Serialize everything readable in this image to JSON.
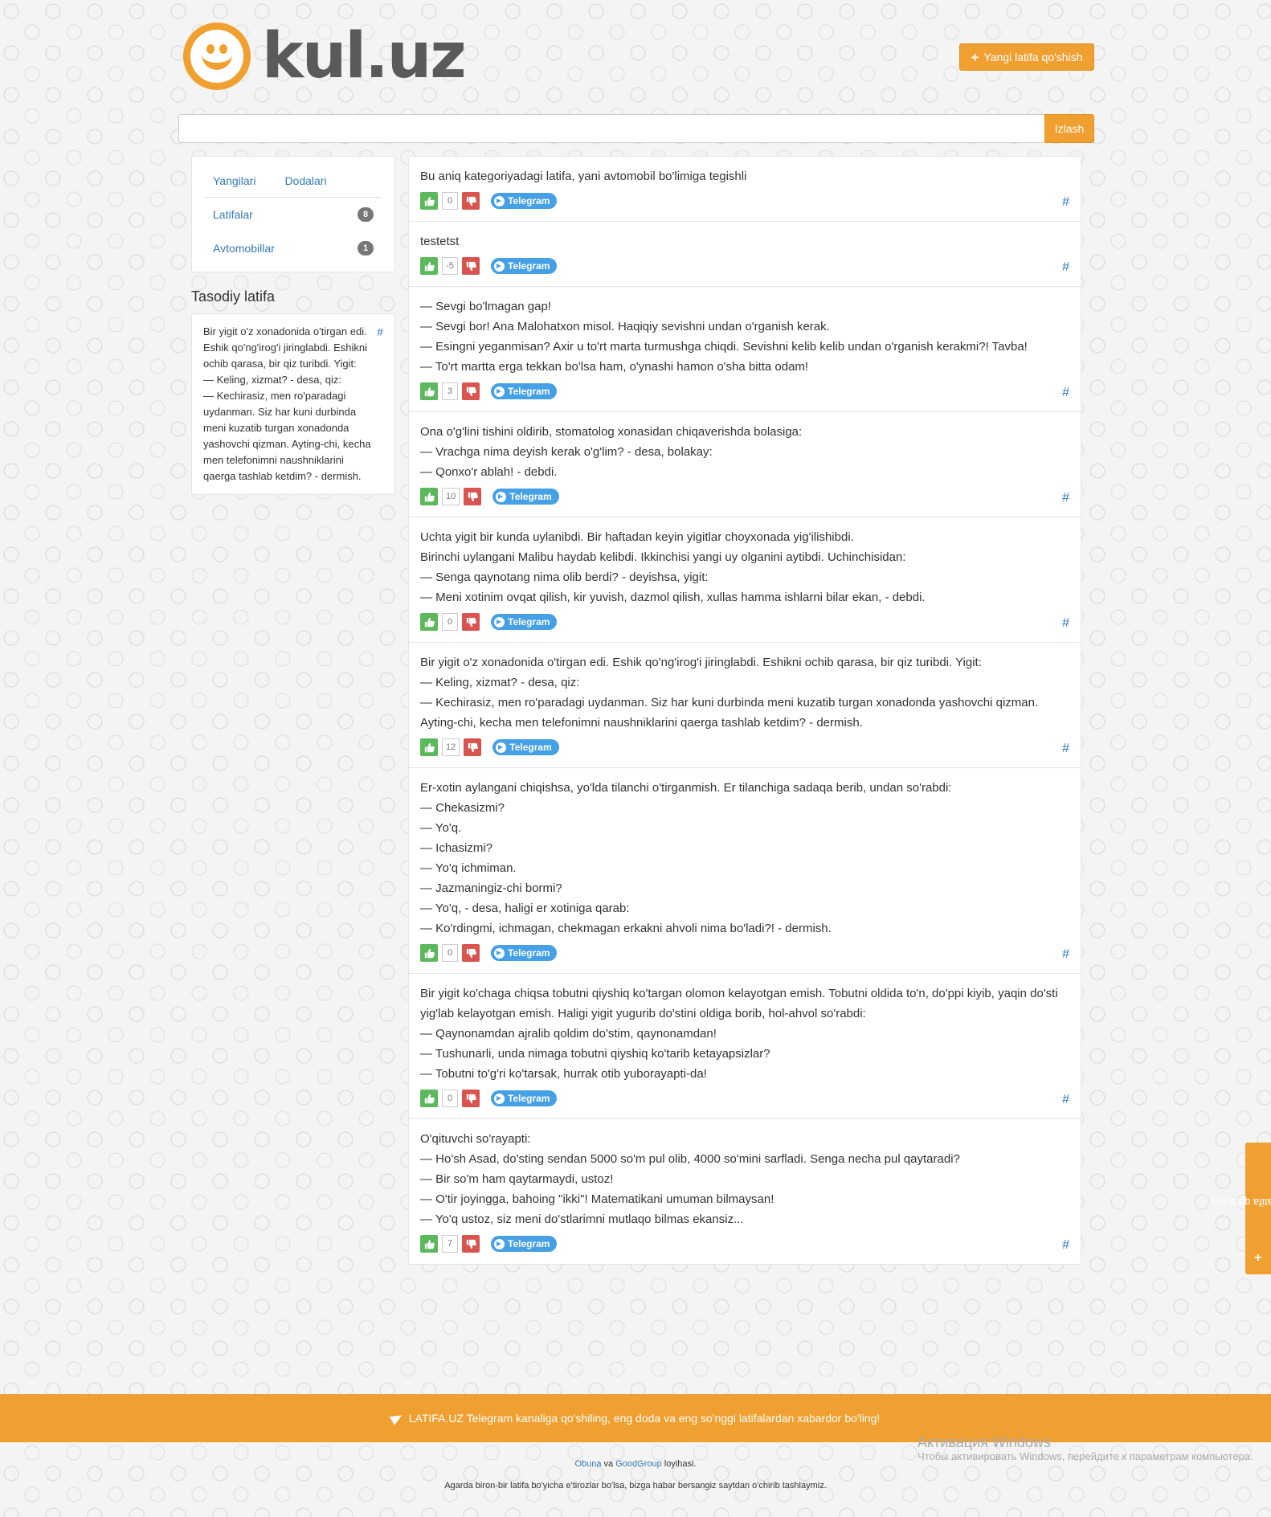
{
  "header": {
    "logo_text": "kul.uz",
    "add_button_label": "Yangi latifa qo'shish"
  },
  "search": {
    "placeholder": "",
    "button_label": "Izlash"
  },
  "sidebar": {
    "tabs": [
      "Yangilari",
      "Dodalari"
    ],
    "categories": [
      {
        "label": "Latifalar",
        "count": "8"
      },
      {
        "label": "Avtomobillar",
        "count": "1"
      }
    ],
    "random_title": "Tasodiy latifa",
    "random_hash": "#",
    "random_text": "Bir yigit o'z xonadonida o'tirgan edi. Eshik qo'ng'irog'i jiringlabdi. Eshikni ochib qarasa, bir qiz turibdi. Yigit:\n— Keling, xizmat? - desa, qiz:\n— Kechirasiz, men ro'paradagi uydanman. Siz har kuni durbinda meni kuzatib turgan xonadonda yashovchi qizman. Ayting-chi, kecha men telefonimni naushniklarini qaerga tashlab ketdim? - dermish."
  },
  "posts": [
    {
      "text": "Bu aniq kategoriyadagi latifa, yani avtomobil bo'limiga tegishli",
      "votes": "0",
      "telegram": "Telegram",
      "hash": "#"
    },
    {
      "text": "testetst",
      "votes": "-5",
      "telegram": "Telegram",
      "hash": "#"
    },
    {
      "text": "— Sevgi bo'lmagan gap!\n— Sevgi bor! Ana Malohatxon misol. Haqiqiy sevishni undan o'rganish kerak.\n— Esingni yeganmisan? Axir u to'rt marta turmushga chiqdi. Sevishni kelib kelib undan o'rganish kerakmi?! Tavba!\n— To'rt martta erga tekkan bo'lsa ham, o'ynashi hamon o'sha bitta odam!",
      "votes": "3",
      "telegram": "Telegram",
      "hash": "#"
    },
    {
      "text": "Ona o'g'lini tishini oldirib, stomatolog xonasidan chiqaverishda bolasiga:\n— Vrachga nima deyish kerak o'g'lim? - desa, bolakay:\n— Qonxo'r ablah! - debdi.",
      "votes": "10",
      "telegram": "Telegram",
      "hash": "#"
    },
    {
      "text": "Uchta yigit bir kunda uylanibdi. Bir haftadan keyin yigitlar choyxonada yig'ilishibdi.\nBirinchi uylangani Malibu haydab kelibdi. Ikkinchisi yangi uy olganini aytibdi. Uchinchisidan:\n— Senga qaynotang nima olib berdi? - deyishsa, yigit:\n— Meni xotinim ovqat qilish, kir yuvish, dazmol qilish, xullas hamma ishlarni bilar ekan, - debdi.",
      "votes": "0",
      "telegram": "Telegram",
      "hash": "#"
    },
    {
      "text": "Bir yigit o'z xonadonida o'tirgan edi. Eshik qo'ng'irog'i jiringlabdi. Eshikni ochib qarasa, bir qiz turibdi. Yigit:\n— Keling, xizmat? - desa, qiz:\n— Kechirasiz, men ro'paradagi uydanman. Siz har kuni durbinda meni kuzatib turgan xonadonda yashovchi qizman. Ayting-chi, kecha men telefonimni naushniklarini qaerga tashlab ketdim? - dermish.",
      "votes": "12",
      "telegram": "Telegram",
      "hash": "#"
    },
    {
      "text": "Er-xotin aylangani chiqishsa, yo'lda tilanchi o'tirganmish. Er tilanchiga sadaqa berib, undan so'rabdi:\n— Chekasizmi?\n— Yo'q.\n— Ichasizmi?\n— Yo'q ichmiman.\n— Jazmaningiz-chi bormi?\n— Yo'q, - desa, haligi er xotiniga qarab:\n— Ko'rdingmi, ichmagan, chekmagan erkakni ahvoli nima bo'ladi?! - dermish.",
      "votes": "0",
      "telegram": "Telegram",
      "hash": "#"
    },
    {
      "text": "Bir yigit ko'chaga chiqsa tobutni qiyshiq ko'targan olomon kelayotgan emish. Tobutni oldida to'n, do'ppi kiyib, yaqin do'sti yig'lab kelayotgan emish. Haligi yigit yugurib do'stini oldiga borib, hol-ahvol so'rabdi:\n— Qaynonamdan ajralib qoldim do'stim, qaynonamdan!\n— Tushunarli, unda nimaga tobutni qiyshiq ko'tarib ketayapsizlar?\n— Tobutni to'g'ri ko'tarsak, hurrak otib yuborayapti-da!",
      "votes": "0",
      "telegram": "Telegram",
      "hash": "#"
    },
    {
      "text": "O'qituvchi so'rayapti:\n— Ho'sh Asad, do'sting sendan 5000 so'm pul olib, 4000 so'mini sarfladi. Senga necha pul qaytaradi?\n— Bir so'm ham qaytarmaydi, ustoz!\n— O'tir joyingga, bahoing \"ikki\"! Matematikani umuman bilmaysan!\n— Yo'q ustoz, siz meni do'stlarimni mutlaqo bilmas ekansiz...",
      "votes": "7",
      "telegram": "Telegram",
      "hash": "#"
    }
  ],
  "side_tab_label": "Yangi latifa qo'shish",
  "footer": {
    "banner_text": "LATIFA.UZ Telegram kanaliga qo'shiling, eng doda va eng so'nggi latifalardan xabardor bo'ling!",
    "credit_link1": "Obuna",
    "credit_mid": " va ",
    "credit_link2": "GoodGroup",
    "credit_end": " loyihasi.",
    "disclaimer": "Agarda biron-bir latifa bo'yicha e'tirozlar bo'lsa, bizga habar bersangiz saytdan o'chirib tashlaymiz."
  },
  "windows_notice": {
    "title": "Активация Windows",
    "text": "Чтобы активировать Windows, перейдите к параметрам компьютера."
  },
  "colors": {
    "accent": "#f0a030",
    "link": "#337ab7",
    "upvote": "#5cb85c",
    "downvote": "#d9534f",
    "telegram": "#45a0e6"
  }
}
